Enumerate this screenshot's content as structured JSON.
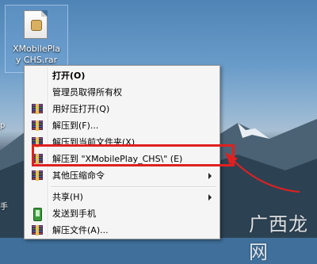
{
  "desktop_icon": {
    "label_line1": "XMobilePla",
    "label_line2": "y CHS.rar"
  },
  "context_menu": {
    "items": [
      {
        "label": "打开(O)",
        "bold": true
      },
      {
        "label": "管理员取得所有权"
      },
      {
        "label": "用好压打开(Q)",
        "icon": "winrar-icon"
      },
      {
        "label": "解压到(F)...",
        "icon": "winrar-icon"
      },
      {
        "label": "解压到当前文件夹(X)",
        "icon": "winrar-icon"
      },
      {
        "label": "解压到 \"XMobilePlay_CHS\\\" (E)",
        "icon": "winrar-icon",
        "highlighted": true
      },
      {
        "label": "其他压缩命令",
        "icon": "winrar-icon",
        "submenu": true
      },
      {
        "label": "共享(H)",
        "submenu": true
      },
      {
        "label": "发送到手机",
        "icon": "phone-icon"
      },
      {
        "label": "解压文件(A)...",
        "icon": "winrar-icon"
      }
    ]
  },
  "left_edge_chars": [
    "p",
    "手"
  ],
  "watermark": {
    "text": "广西龙网"
  },
  "colors": {
    "annotation": "#e02020",
    "menu_bg": "#f5f5f5"
  }
}
